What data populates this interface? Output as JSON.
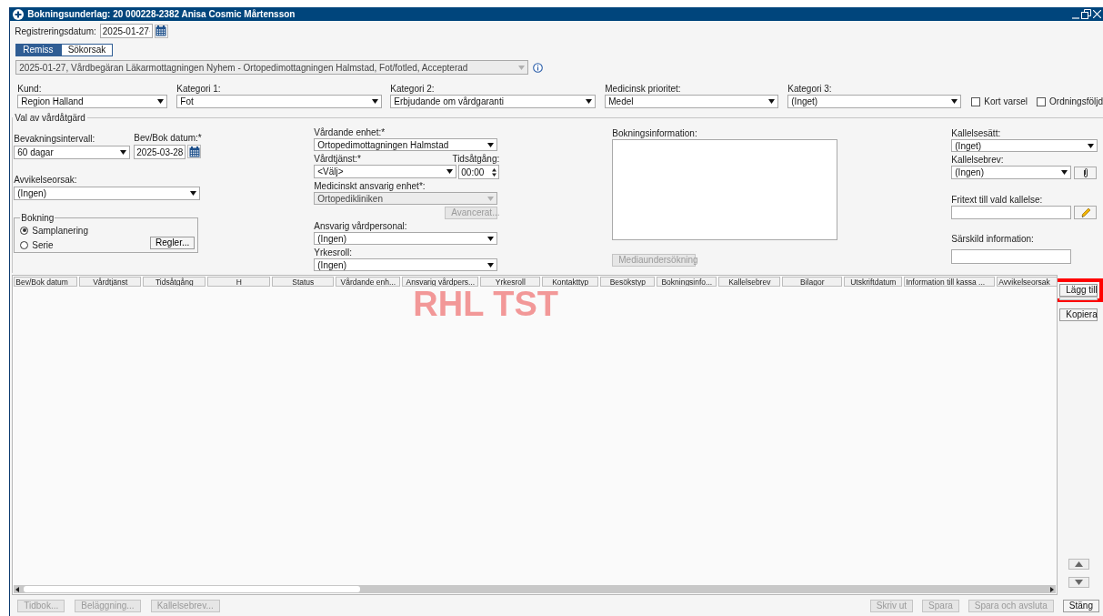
{
  "window": {
    "title": "Bokningsunderlag: 20 000228-2382 Anisa Cosmic Mårtensson"
  },
  "registration": {
    "label": "Registreringsdatum:",
    "value": "2025-01-27"
  },
  "tabs": [
    {
      "label": "Remiss",
      "selected": true
    },
    {
      "label": "Sökorsak",
      "selected": false
    }
  ],
  "referral": {
    "value": "2025-01-27, Vårdbegäran Läkarmottagningen Nyhem - Ortopedimottagningen Halmstad, Fot/fotled, Accepterad",
    "disabled": true
  },
  "top_fields": [
    {
      "label": "Kund:",
      "value": "Region Halland"
    },
    {
      "label": "Kategori 1:",
      "value": "Fot"
    },
    {
      "label": "Kategori 2:",
      "value": "Erbjudande om vårdgaranti"
    },
    {
      "label": "Medicinsk prioritet:",
      "value": "Medel"
    },
    {
      "label": "Kategori 3:",
      "value": "(Inget)"
    }
  ],
  "checkboxes": [
    {
      "label": "Kort varsel",
      "checked": false
    },
    {
      "label": "Ordningsföljd",
      "checked": false
    }
  ],
  "section": {
    "title": "Val av vårdåtgärd"
  },
  "monitoring": {
    "label": "Bevakningsintervall:",
    "value": "60 dagar"
  },
  "booking_date": {
    "label": "Bev/Bok datum:*",
    "value": "2025-03-28"
  },
  "deviation": {
    "label": "Avvikelseorsak:",
    "value": "(Ingen)"
  },
  "booking_group": {
    "title": "Bokning",
    "options": [
      {
        "label": "Samplanering",
        "selected": true
      },
      {
        "label": "Serie",
        "selected": false
      }
    ],
    "rules_button": "Regler..."
  },
  "care_unit": {
    "label": "Vårdande enhet:*",
    "value": "Ortopedimottagningen Halmstad"
  },
  "care_service": {
    "label": "Vårdtjänst:*",
    "value": "<Välj>"
  },
  "duration": {
    "label": "Tidsåtgång:",
    "value": "00:00"
  },
  "responsible_unit": {
    "label": "Medicinskt ansvarig enhet*:",
    "value": "Ortopedikliniken",
    "disabled": true
  },
  "advanced_button": {
    "label": "Avancerat...",
    "disabled": true
  },
  "staff": {
    "label": "Ansvarig vårdpersonal:",
    "value": "(Ingen)"
  },
  "role": {
    "label": "Yrkesroll:",
    "value": "(Ingen)"
  },
  "booking_info": {
    "label": "Bokningsinformation:"
  },
  "media_button": {
    "label": "Mediaundersökning",
    "disabled": true
  },
  "summons_method": {
    "label": "Kallelsesätt:",
    "value": "(Inget)"
  },
  "summons_letter": {
    "label": "Kallelsebrev:",
    "value": "(Ingen)"
  },
  "free_text": {
    "label": "Fritext till vald kallelse:"
  },
  "special_info": {
    "label": "Särskild information:"
  },
  "table": {
    "columns": [
      "Bev/Bok datum",
      "Vårdtjänst",
      "Tidsåtgång",
      "H",
      "Status",
      "Vårdande enh...",
      "Ansvarig vårdpers...",
      "Yrkesroll",
      "Kontakttyp",
      "Besökstyp",
      "Bokningsinfo...",
      "Kallelsebrev",
      "Bilagor",
      "Utskriftdatum",
      "Information till kassa ...",
      "Avvikelseorsak"
    ]
  },
  "environment_label": "RHL TST",
  "side_buttons": [
    {
      "label": "Lägg till",
      "disabled": false,
      "highlighted": true
    },
    {
      "label": "Kopiera",
      "disabled": false,
      "highlighted": false
    }
  ],
  "footer_left": [
    {
      "label": "Tidbok...",
      "disabled": true
    },
    {
      "label": "Beläggning...",
      "disabled": true
    },
    {
      "label": "Kallelsebrev...",
      "disabled": true
    }
  ],
  "footer_right": [
    {
      "label": "Skriv ut",
      "disabled": true
    },
    {
      "label": "Spara",
      "disabled": true
    },
    {
      "label": "Spara och avsluta",
      "disabled": true
    },
    {
      "label": "Stäng",
      "disabled": false
    }
  ]
}
